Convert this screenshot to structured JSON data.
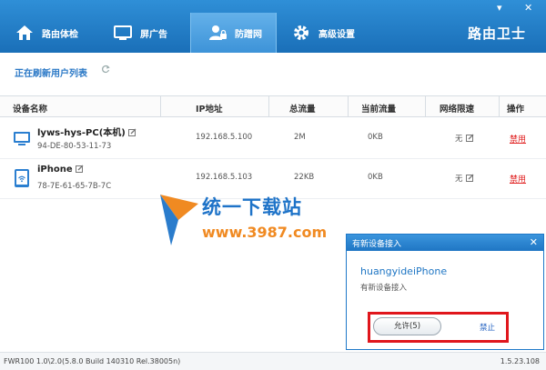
{
  "window": {
    "minimize": "▾",
    "close": "✕"
  },
  "tabs": [
    {
      "label": "路由体检",
      "icon": "home-icon"
    },
    {
      "label": "屏广告",
      "icon": "monitor-icon"
    },
    {
      "label": "防蹭网",
      "icon": "user-lock-icon"
    },
    {
      "label": "高级设置",
      "icon": "gear-icon"
    }
  ],
  "brand": "路由卫士",
  "list": {
    "title": "正在刷新用户列表",
    "refresh_icon": "refresh-icon"
  },
  "columns": [
    "设备名称",
    "IP地址",
    "总流量",
    "当前流量",
    "网络限速",
    "操作"
  ],
  "devices": [
    {
      "name": "lyws-hys-PC(本机)",
      "mac": "94-DE-80-53-11-73",
      "ip": "192.168.5.100",
      "total": "2M",
      "current": "0KB",
      "limit": "无",
      "action": "禁用",
      "icon": "desktop-icon"
    },
    {
      "name": "iPhone",
      "mac": "78-7E-61-65-7B-7C",
      "ip": "192.168.5.103",
      "total": "22KB",
      "current": "0KB",
      "limit": "无",
      "action": "禁用",
      "icon": "tablet-icon"
    }
  ],
  "watermark": {
    "name": "统一下载站",
    "url": "www.3987.com"
  },
  "popup": {
    "title": "有新设备接入",
    "close": "✕",
    "device": "huangyideiPhone",
    "message": "有新设备接入",
    "allow": "允许(5)",
    "deny": "禁止"
  },
  "footer": {
    "version": "FWR100 1.0\\2.0(5.8.0 Build 140310 Rel.38005n)",
    "build": "1.5.23.108"
  },
  "colors": {
    "accent": "#1f76c4",
    "danger": "#e02020",
    "highlight": "#e0161c",
    "watermark_orange": "#f08a22"
  }
}
